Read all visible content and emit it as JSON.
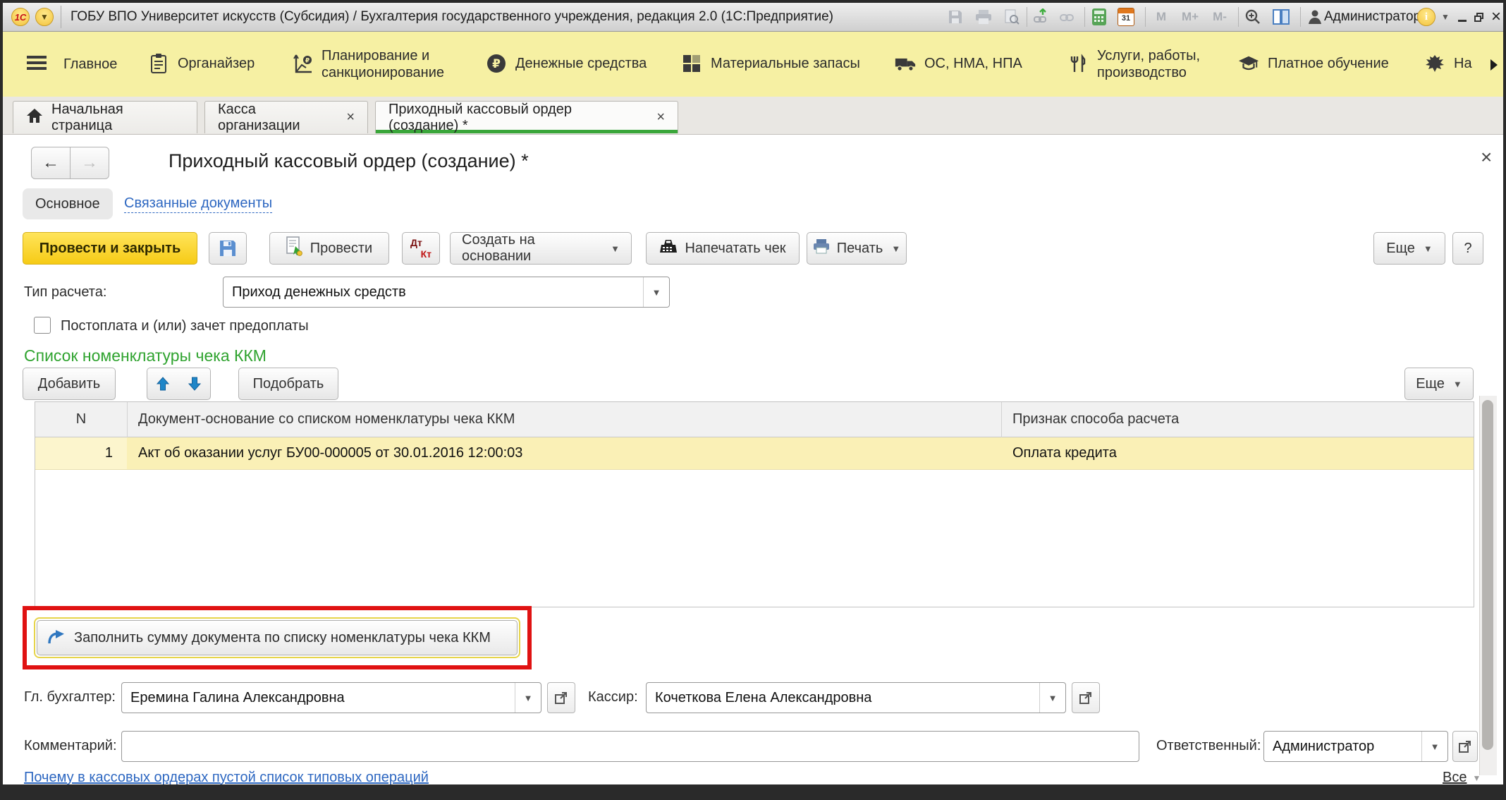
{
  "colors": {
    "ribbon_bg": "#f6f0a3",
    "action_yellow": "#fcd63f",
    "green_heading": "#2fa32f",
    "tab_underline_green": "#3aa63a",
    "link_blue": "#2d67c1",
    "annotation_red": "#e01212",
    "row_yellow": "#faf0b6"
  },
  "titlebar": {
    "logo": "1С",
    "title": "ГОБУ ВПО Университет искусств (Субсидия) / Бухгалтерия государственного учреждения, редакция 2.0  (1С:Предприятие)",
    "memory": {
      "m": "M",
      "m_plus": "M+",
      "m_minus": "M-"
    },
    "calendar_day": "31",
    "user": "Администратор"
  },
  "ribbon": {
    "items": [
      {
        "label": "Главное"
      },
      {
        "label": "Органайзер"
      },
      {
        "label": "Планирование и санкционирование"
      },
      {
        "label": "Денежные средства"
      },
      {
        "label": "Материальные запасы"
      },
      {
        "label": "ОС, НМА, НПА"
      },
      {
        "label": "Услуги, работы, производство"
      },
      {
        "label": "Платное обучение"
      },
      {
        "label": "На"
      }
    ]
  },
  "tabs": {
    "home": "Начальная страница",
    "kassa": "Касса организации",
    "pko": "Приходный кассовый ордер (создание) *"
  },
  "page": {
    "title": "Приходный кассовый ордер (создание) *",
    "nav_main": "Основное",
    "nav_related": "Связанные документы"
  },
  "toolbar": {
    "post_close": "Провести и закрыть",
    "post": "Провести",
    "dt": "Дт",
    "kt": "Кт",
    "create_based": "Создать на основании",
    "print_receipt": "Напечатать чек",
    "print": "Печать",
    "more": "Еще",
    "help": "?"
  },
  "form": {
    "calc_type_label": "Тип расчета:",
    "calc_type_value": "Приход денежных средств",
    "postpay_checkbox": "Постоплата и (или) зачет предоплаты",
    "chief_label": "Гл. бухгалтер:",
    "chief_value": "Еремина Галина Александровна",
    "cashier_label": "Кассир:",
    "cashier_value": "Кочеткова Елена Александровна",
    "comment_label": "Комментарий:",
    "comment_value": "",
    "responsible_label": "Ответственный:",
    "responsible_value": "Администратор"
  },
  "list": {
    "section_title": "Список номенклатуры чека ККМ",
    "add": "Добавить",
    "pick": "Подобрать",
    "more": "Еще",
    "headers": {
      "n": "N",
      "doc": "Документ-основание со списком номенклатуры чека ККМ",
      "method": "Признак способа расчета"
    },
    "rows": [
      {
        "n": "1",
        "doc": "Акт об оказании услуг БУ00-000005 от 30.01.2016 12:00:03",
        "method": "Оплата кредита"
      }
    ]
  },
  "fill_button": {
    "label": "Заполнить сумму документа по списку номенклатуры чека ККМ"
  },
  "footer": {
    "link": "Почему в кассовых ордерах пустой список типовых операций",
    "all": "Все"
  }
}
